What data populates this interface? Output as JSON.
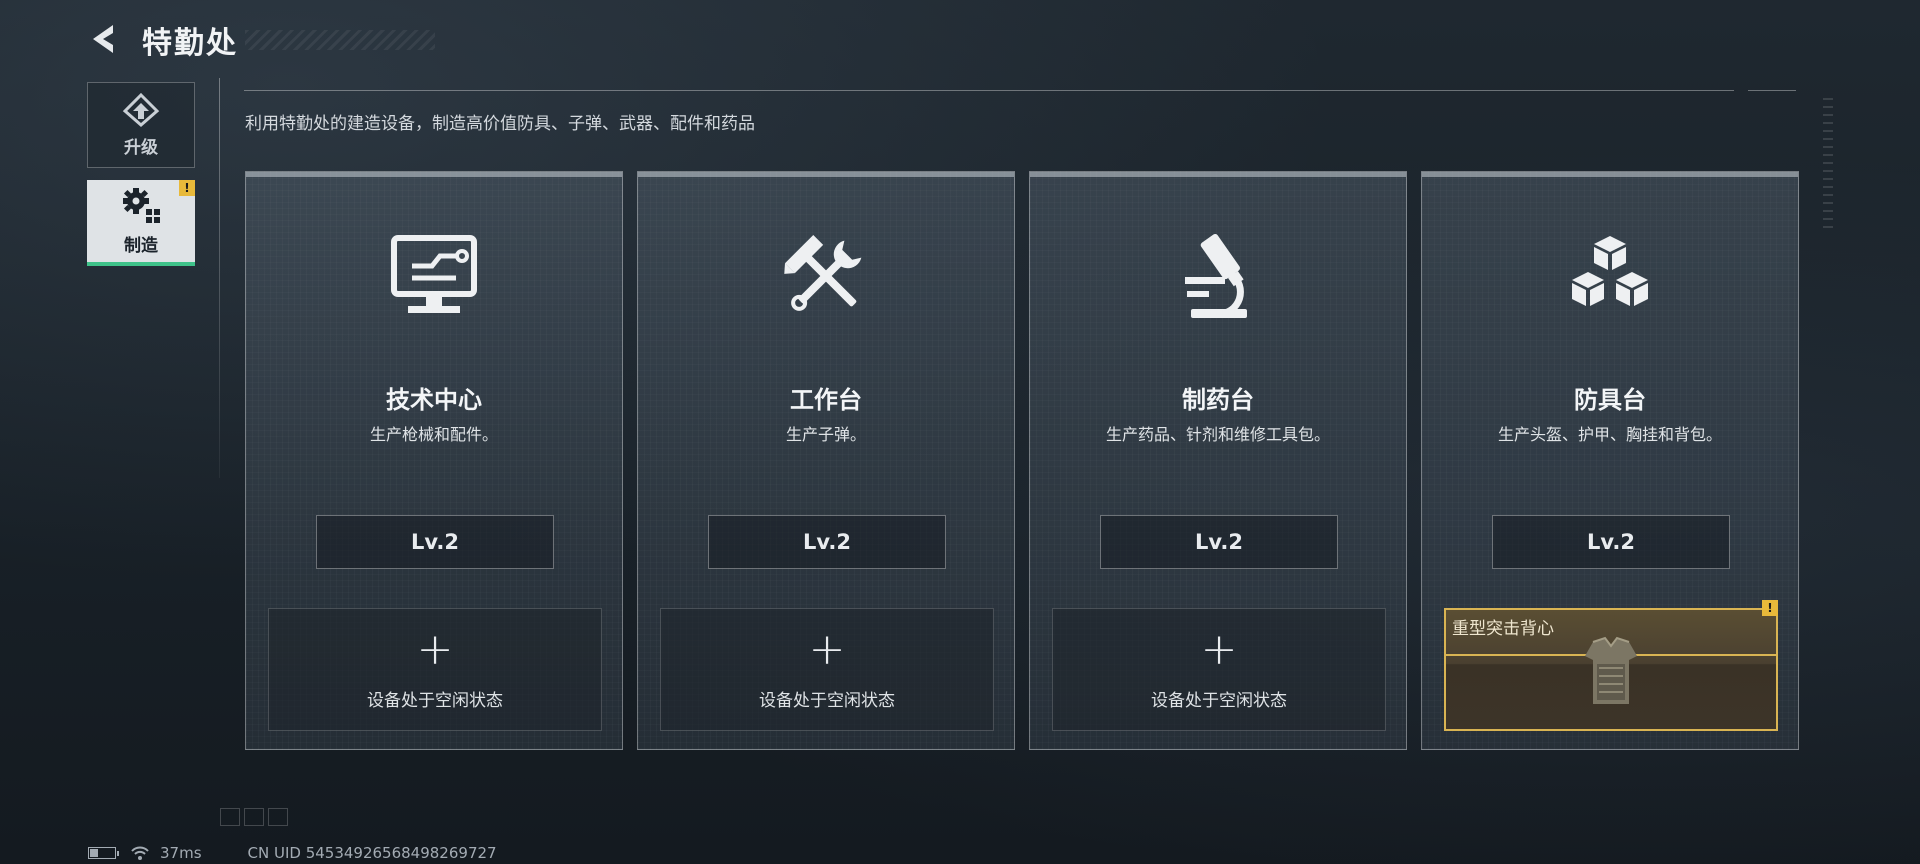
{
  "header": {
    "title": "特勤处",
    "back_icon": "back-arrow-icon"
  },
  "nav": {
    "items": [
      {
        "label": "升级",
        "icon": "upgrade-icon",
        "active": false
      },
      {
        "label": "制造",
        "icon": "gears-icon",
        "active": true,
        "badge": "!"
      }
    ]
  },
  "description": "利用特勤处的建造设备，制造高价值防具、子弹、武器、配件和药品",
  "stations": [
    {
      "name": "技术中心",
      "desc": "生产枪械和配件。",
      "level": "Lv.2",
      "icon": "computer-icon",
      "slot_plus": "+",
      "slot_status": "设备处于空闲状态"
    },
    {
      "name": "工作台",
      "desc": "生产子弹。",
      "level": "Lv.2",
      "icon": "hammer-wrench-icon",
      "slot_plus": "+",
      "slot_status": "设备处于空闲状态"
    },
    {
      "name": "制药台",
      "desc": "生产药品、针剂和维修工具包。",
      "level": "Lv.2",
      "icon": "microscope-icon",
      "slot_plus": "+",
      "slot_status": "设备处于空闲状态"
    },
    {
      "name": "防具台",
      "desc": "生产头盔、护甲、胸挂和背包。",
      "level": "Lv.2",
      "icon": "cubes-icon",
      "producing": "重型突击背心",
      "badge": "!"
    }
  ],
  "footer": {
    "ping": "37ms",
    "uid": "CN UID 54534926568498269727"
  },
  "colors": {
    "accent_green": "#3fc28a",
    "badge_yellow": "#e8b93a",
    "producing_gold": "#d9b453"
  }
}
